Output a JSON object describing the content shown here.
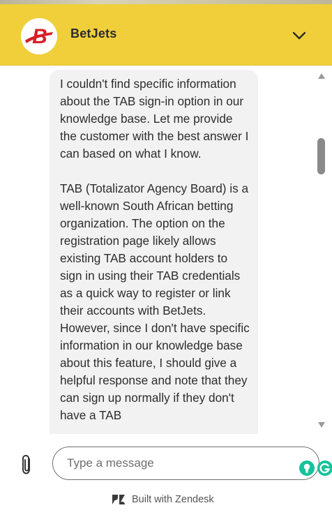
{
  "header": {
    "brand_name": "BetJets",
    "logo_letter": "B",
    "background": "#f0cf3a"
  },
  "conversation": {
    "messages": [
      {
        "sender": "bot",
        "paragraphs": [
          "I couldn't find specific information about the TAB sign-in option in our knowledge base. Let me provide the customer with the best answer I can based on what I know.",
          "TAB (Totalizator Agency Board) is a well-known South African betting organization. The option on the registration page likely allows existing TAB account holders to sign in using their TAB credentials as a quick way to register or link their accounts with BetJets. However, since I don't have specific information in our knowledge base about this feature, I should give a helpful response and note that they can sign up normally if they don't have a TAB"
        ]
      }
    ]
  },
  "composer": {
    "placeholder": "Type a message",
    "value": ""
  },
  "footer": {
    "built_with": "Built with Zendesk"
  },
  "icons": {
    "collapse": "chevron-down-icon",
    "attach": "paperclip-icon",
    "extension_1": "lightbulb-icon",
    "extension_2": "grammarly-icon",
    "footer": "zendesk-icon"
  },
  "colors": {
    "header": "#f0cf3a",
    "logo_red": "#d81f26",
    "bubble": "#f2f2f2",
    "grammarly_green": "#15c39a"
  }
}
